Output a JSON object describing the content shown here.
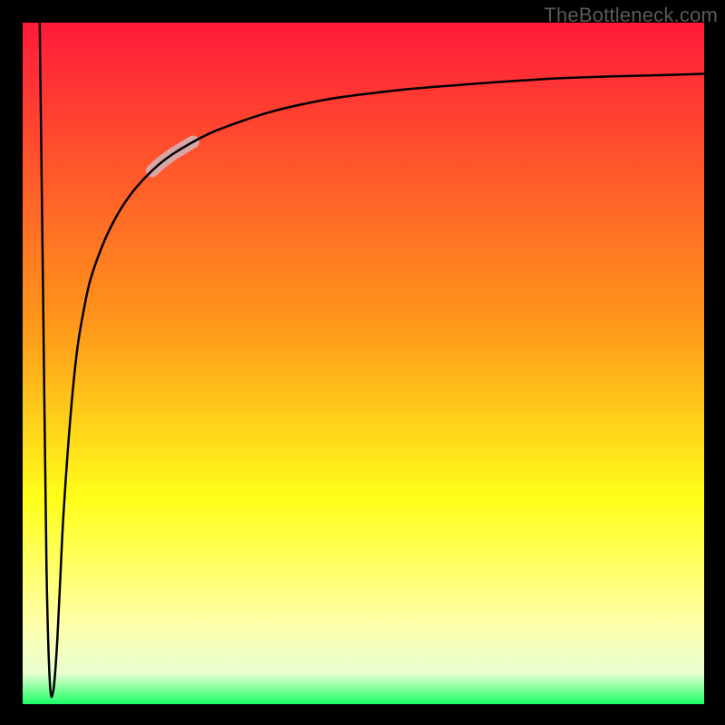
{
  "watermark": "TheBottleneck.com",
  "chart_data": {
    "type": "line",
    "title": "",
    "xlabel": "",
    "ylabel": "",
    "xlim": [
      0,
      100
    ],
    "ylim": [
      0,
      100
    ],
    "grid": false,
    "legend": false,
    "background_gradient": [
      {
        "stop": 0.0,
        "color": "#ff1a3a"
      },
      {
        "stop": 0.45,
        "color": "#ff9a1a"
      },
      {
        "stop": 0.7,
        "color": "#ffff1a"
      },
      {
        "stop": 0.88,
        "color": "#ffffa8"
      },
      {
        "stop": 0.955,
        "color": "#e9ffd0"
      },
      {
        "stop": 1.0,
        "color": "#1aff66"
      }
    ],
    "series": [
      {
        "name": "bottleneck-curve",
        "color": "#000000",
        "thick_segment": {
          "x_start": 19,
          "x_end": 25,
          "color": "#d9a6a6"
        },
        "x": [
          2.5,
          3.0,
          3.5,
          4.0,
          4.5,
          5.0,
          5.5,
          6.0,
          7.0,
          8.0,
          9.0,
          10.0,
          12.0,
          14.0,
          16.0,
          18.0,
          20.0,
          22.0,
          25.0,
          28.0,
          32.0,
          36.0,
          40.0,
          45.0,
          50.0,
          56.0,
          62.0,
          70.0,
          78.0,
          86.0,
          94.0,
          100.0
        ],
        "y": [
          100.0,
          60.0,
          20.0,
          3.0,
          2.0,
          8.0,
          18.0,
          28.0,
          42.0,
          52.0,
          58.0,
          62.5,
          68.0,
          72.0,
          75.0,
          77.3,
          79.2,
          80.7,
          82.5,
          84.0,
          85.5,
          86.8,
          87.8,
          88.8,
          89.5,
          90.2,
          90.7,
          91.3,
          91.8,
          92.1,
          92.3,
          92.5
        ]
      }
    ]
  }
}
